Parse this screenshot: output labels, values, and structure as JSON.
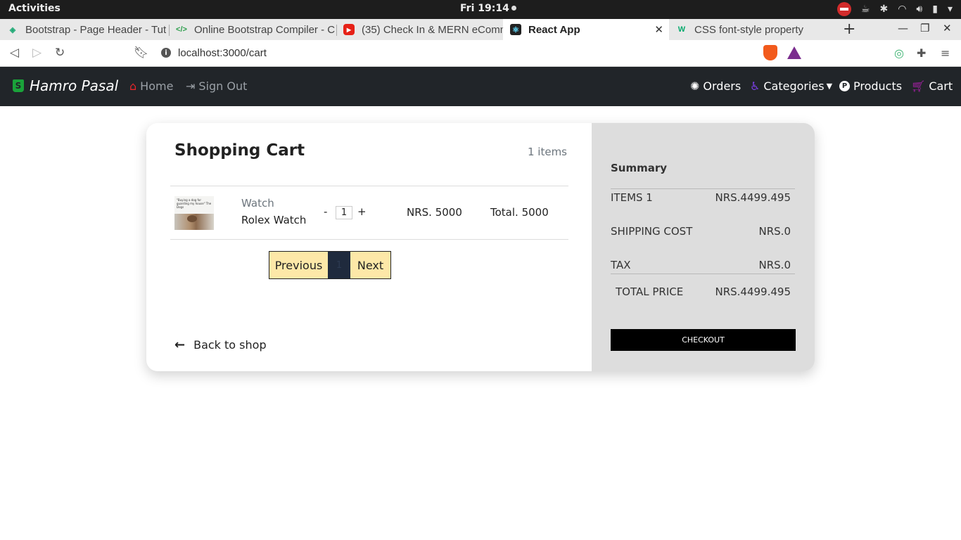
{
  "desktop": {
    "activities": "Activities",
    "clock": "Fri 19:14"
  },
  "browser": {
    "tabs": [
      {
        "title": "Bootstrap - Page Header - Tut"
      },
      {
        "title": "Online Bootstrap Compiler - C"
      },
      {
        "title": "(35) Check In & MERN eComm"
      },
      {
        "title": "React App"
      },
      {
        "title": "CSS font-style property"
      }
    ],
    "url": "localhost:3000/cart"
  },
  "app": {
    "brand": "Hamro Pasal",
    "nav_left": [
      {
        "label": "Home",
        "icon": "home-icon"
      },
      {
        "label": "Sign Out",
        "icon": "sign-out-icon"
      }
    ],
    "nav_right": [
      {
        "label": "Orders",
        "icon": "orders-icon"
      },
      {
        "label": "Categories",
        "icon": "categories-icon"
      },
      {
        "label": "Products",
        "icon": "products-icon"
      },
      {
        "label": "Cart",
        "icon": "cart-icon"
      }
    ]
  },
  "cart": {
    "title": "Shopping Cart",
    "item_count": "1 items",
    "items": [
      {
        "category": "Watch",
        "name": "Rolex Watch",
        "minus": "-",
        "quantity": "1",
        "plus": "+",
        "price": "NRS. 5000",
        "total": "Total. 5000",
        "image_caption": "\"Buying a dog for guarding my house\" The Dogs"
      }
    ],
    "pagination": {
      "previous": "Previous",
      "current": "1",
      "next": "Next"
    },
    "back_label": "Back to shop"
  },
  "summary": {
    "title": "Summary",
    "rows": [
      {
        "label": "ITEMS 1",
        "value": "NRS.4499.495"
      },
      {
        "label": "SHIPPING COST",
        "value": "NRS.0"
      },
      {
        "label": "TAX",
        "value": "NRS.0"
      },
      {
        "label": "TOTAL PRICE",
        "value": "NRS.4499.495"
      }
    ],
    "checkout_label": "CHECKOUT"
  },
  "colors": {
    "navbar_bg": "#212529",
    "summary_bg": "#dddddd",
    "pager_bg": "#fde8a8",
    "pager_active": "#1f2a3d",
    "checkout_bg": "#000000"
  }
}
